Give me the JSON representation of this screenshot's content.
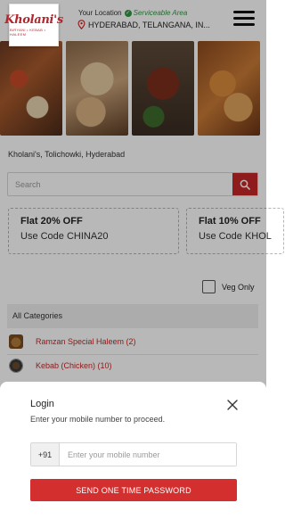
{
  "header": {
    "logo_text": "Kholani's",
    "logo_subtext": "BIRYANI • KEBAB • HALEEM",
    "location_label": "Your Location",
    "location_status": "Serviceable Area",
    "location_city": "HYDERABAD, TELANGANA, IN..."
  },
  "store": {
    "name": "Kholani's, Tolichowki, Hyderabad"
  },
  "search": {
    "placeholder": "Search"
  },
  "coupons": [
    {
      "title": "Flat 20% OFF",
      "code": "Use Code CHINA20"
    },
    {
      "title": "Flat 10% OFF",
      "code": "Use Code KHOL"
    }
  ],
  "filter": {
    "veg_only_label": "Veg Only",
    "veg_only_checked": false
  },
  "categories": {
    "heading": "All Categories",
    "items": [
      {
        "label": "Ramzan Special Haleem (2)",
        "icon": "haleem-dish-icon"
      },
      {
        "label": "Kebab (Chicken) (10)",
        "icon": "kebab-plate-icon"
      }
    ]
  },
  "login": {
    "title": "Login",
    "subtitle": "Enter your mobile number to proceed.",
    "country_code": "+91",
    "phone_placeholder": "Enter your mobile number",
    "submit_label": "SEND ONE TIME PASSWORD"
  },
  "colors": {
    "brand_red": "#c62828",
    "serviceable_green": "#2e9a3e",
    "overlay": "rgba(0,0,0,0.28)"
  }
}
